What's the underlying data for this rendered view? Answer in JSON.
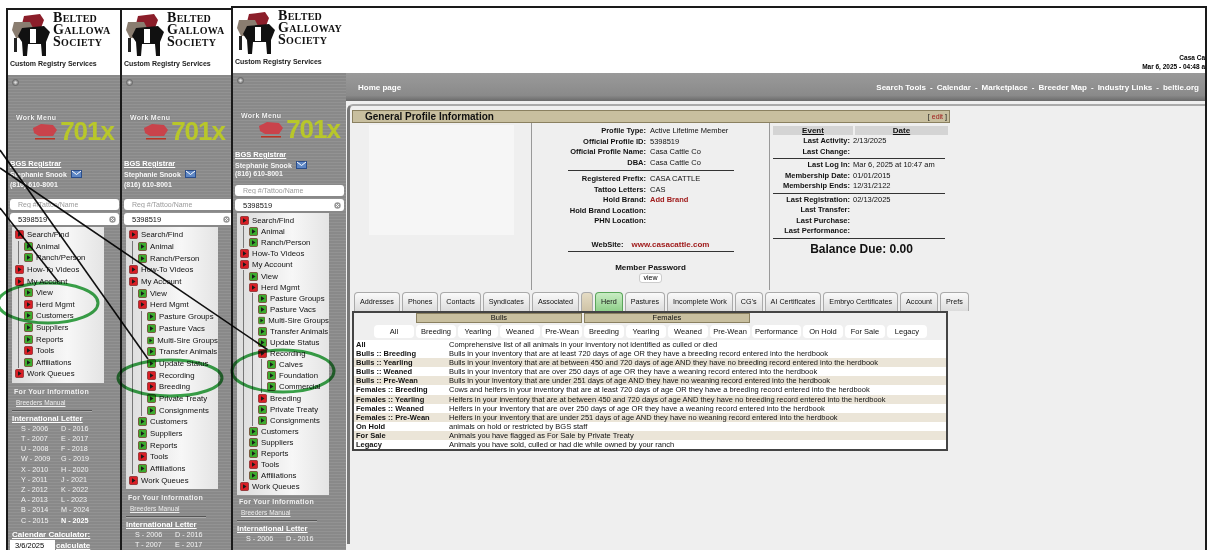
{
  "panels": [
    {
      "brand": [
        "Belted",
        "Gallowa",
        "Society"
      ],
      "tagline": "Custom Registry Services",
      "work_menu": "Work Menu",
      "product": "701x",
      "registrar": {
        "title": "BGS Registrar",
        "name": "Stephanie Snook",
        "phone": "(816) 610-8001"
      },
      "search": {
        "placeholder": "Reg #/Tattoo/Name"
      },
      "reg_field": {
        "value": "5398519"
      },
      "menu": [
        {
          "label": "Search/Find",
          "kind": "folder",
          "children": [
            {
              "label": "Animal",
              "kind": "page"
            },
            {
              "label": "Ranch/Person",
              "kind": "page"
            }
          ]
        },
        {
          "label": "How-To Videos",
          "kind": "folder"
        },
        {
          "label": "My Account",
          "kind": "folder",
          "children": [
            {
              "label": "View",
              "kind": "page"
            },
            {
              "label": "Herd Mgmt",
              "kind": "folder"
            },
            {
              "label": "Customers",
              "kind": "page"
            },
            {
              "label": "Suppliers",
              "kind": "page"
            },
            {
              "label": "Reports",
              "kind": "page"
            },
            {
              "label": "Tools",
              "kind": "folder"
            },
            {
              "label": "Affiliations",
              "kind": "page"
            }
          ]
        },
        {
          "label": "Work Queues",
          "kind": "folder"
        }
      ],
      "info_heading": "For Your Information",
      "manual": "Breeders Manual",
      "letter_heading": "International Letter",
      "letters": [
        {
          "text": "S - 2006",
          "current": false
        },
        {
          "text": "D - 2016",
          "current": false
        },
        {
          "text": "T - 2007",
          "current": false
        },
        {
          "text": "E - 2017",
          "current": false
        },
        {
          "text": "U - 2008",
          "current": false
        },
        {
          "text": "F - 2018",
          "current": false
        },
        {
          "text": "W - 2009",
          "current": false
        },
        {
          "text": "G - 2019",
          "current": false
        },
        {
          "text": "X - 2010",
          "current": false
        },
        {
          "text": "H - 2020",
          "current": false
        },
        {
          "text": "Y - 2011",
          "current": false
        },
        {
          "text": "J - 2021",
          "current": false
        },
        {
          "text": "Z - 2012",
          "current": false
        },
        {
          "text": "K - 2022",
          "current": false
        },
        {
          "text": "A - 2013",
          "current": false
        },
        {
          "text": "L - 2023",
          "current": false
        },
        {
          "text": "B - 2014",
          "current": false
        },
        {
          "text": "M - 2024",
          "current": false
        },
        {
          "text": "C - 2015",
          "current": false
        },
        {
          "text": "N - 2025",
          "current": true
        }
      ],
      "calendar": {
        "label": "Calendar Calculator:",
        "value": "3/6/2025",
        "button": "calculate"
      }
    },
    {
      "brand": [
        "Belted",
        "Gallowa",
        "Society"
      ],
      "tagline": "Custom Registry Services",
      "work_menu": "Work Menu",
      "product": "701x",
      "registrar": {
        "title": "BGS Registrar",
        "name": "Stephanie Snook",
        "phone": "(816) 610-8001"
      },
      "search": {
        "placeholder": "Reg #/Tattoo/Name"
      },
      "reg_field": {
        "value": "5398519"
      },
      "menu": [
        {
          "label": "Search/Find",
          "kind": "folder",
          "children": [
            {
              "label": "Animal",
              "kind": "page"
            },
            {
              "label": "Ranch/Person",
              "kind": "page"
            }
          ]
        },
        {
          "label": "How-To Videos",
          "kind": "folder"
        },
        {
          "label": "My Account",
          "kind": "folder",
          "children": [
            {
              "label": "View",
              "kind": "page"
            },
            {
              "label": "Herd Mgmt",
              "kind": "folder",
              "children": [
                {
                  "label": "Pasture Groups",
                  "kind": "page"
                },
                {
                  "label": "Pasture Vacs",
                  "kind": "page"
                },
                {
                  "label": "Multi-Sire Groups",
                  "kind": "page"
                },
                {
                  "label": "Transfer Animals",
                  "kind": "page"
                },
                {
                  "label": "Update Status",
                  "kind": "page"
                },
                {
                  "label": "Recording",
                  "kind": "folder"
                },
                {
                  "label": "Breeding",
                  "kind": "folder"
                },
                {
                  "label": "Private Treaty",
                  "kind": "page"
                },
                {
                  "label": "Consignments",
                  "kind": "page"
                }
              ]
            },
            {
              "label": "Customers",
              "kind": "page"
            },
            {
              "label": "Suppliers",
              "kind": "page"
            },
            {
              "label": "Reports",
              "kind": "page"
            },
            {
              "label": "Tools",
              "kind": "folder"
            },
            {
              "label": "Affiliations",
              "kind": "page"
            }
          ]
        },
        {
          "label": "Work Queues",
          "kind": "folder"
        }
      ],
      "info_heading": "For Your Information",
      "manual": "Breeders Manual",
      "letter_heading": "International Letter",
      "letters": [
        {
          "text": "S - 2006",
          "current": false
        },
        {
          "text": "D - 2016",
          "current": false
        },
        {
          "text": "T - 2007",
          "current": false
        },
        {
          "text": "E - 2017",
          "current": false
        }
      ]
    },
    {
      "brand": [
        "Belted",
        "Galloway",
        "Society"
      ],
      "tagline": "Custom Registry Services",
      "work_menu": "Work Menu",
      "product": "701x",
      "registrar": {
        "title": "BGS Registrar",
        "name": "Stephanie Snook",
        "phone": "(816) 610-8001"
      },
      "search": {
        "placeholder": "Reg #/Tattoo/Name"
      },
      "reg_field": {
        "value": "5398519"
      },
      "menu": [
        {
          "label": "Search/Find",
          "kind": "folder",
          "children": [
            {
              "label": "Animal",
              "kind": "page"
            },
            {
              "label": "Ranch/Person",
              "kind": "page"
            }
          ]
        },
        {
          "label": "How-To Videos",
          "kind": "folder"
        },
        {
          "label": "My Account",
          "kind": "folder",
          "children": [
            {
              "label": "View",
              "kind": "page"
            },
            {
              "label": "Herd Mgmt",
              "kind": "folder",
              "children": [
                {
                  "label": "Pasture Groups",
                  "kind": "page"
                },
                {
                  "label": "Pasture Vacs",
                  "kind": "page"
                },
                {
                  "label": "Multi-Sire Groups",
                  "kind": "page"
                },
                {
                  "label": "Transfer Animals",
                  "kind": "page"
                },
                {
                  "label": "Update Status",
                  "kind": "page"
                },
                {
                  "label": "Recording",
                  "kind": "folder",
                  "children": [
                    {
                      "label": "Calves",
                      "kind": "page"
                    },
                    {
                      "label": "Foundation",
                      "kind": "page"
                    },
                    {
                      "label": "Commercial",
                      "kind": "page"
                    }
                  ]
                },
                {
                  "label": "Breeding",
                  "kind": "folder"
                },
                {
                  "label": "Private Treaty",
                  "kind": "page"
                },
                {
                  "label": "Consignments",
                  "kind": "page"
                }
              ]
            },
            {
              "label": "Customers",
              "kind": "page"
            },
            {
              "label": "Suppliers",
              "kind": "page"
            },
            {
              "label": "Reports",
              "kind": "page"
            },
            {
              "label": "Tools",
              "kind": "folder"
            },
            {
              "label": "Affiliations",
              "kind": "page"
            }
          ]
        },
        {
          "label": "Work Queues",
          "kind": "folder"
        }
      ],
      "info_heading": "For Your Information",
      "manual": "Breeders Manual",
      "letter_heading": "International Letter",
      "letters": [
        {
          "text": "S - 2006",
          "current": false
        },
        {
          "text": "D - 2016",
          "current": false
        }
      ],
      "account": {
        "name": "Casa Ca",
        "datetime": "Mar 6, 2025 - 04:48 a"
      },
      "main": {
        "nav": {
          "home": "Home page",
          "separator": "-",
          "links": [
            "Search Tools",
            "Calendar",
            "Marketplace",
            "Breeder Map",
            "Industry Links",
            "beltie.org"
          ]
        },
        "profile": {
          "title": "General Profile Information",
          "edit_open": "[",
          "edit": "edit",
          "edit_close": "]",
          "groups": [
            [
              {
                "label": "Profile Type:",
                "value": "Active Lifetime Member",
                "kind": "text"
              },
              {
                "label": "Official Profile ID:",
                "value": "5398519",
                "kind": "text"
              },
              {
                "label": "Official Profile Name:",
                "value": "Casa Cattle Co",
                "kind": "text"
              },
              {
                "label": "DBA:",
                "value": "Casa Cattle Co",
                "kind": "text"
              }
            ],
            [
              {
                "label": "Registered Prefix:",
                "value": "CASA CATTLE",
                "kind": "text"
              },
              {
                "label": "Tattoo Letters:",
                "value": "CAS",
                "kind": "text"
              },
              {
                "label": "Hold Brand:",
                "value": "Add Brand",
                "kind": "link"
              },
              {
                "label": "Hold Brand Location:",
                "kind": "text"
              },
              {
                "label": "PHN Location:",
                "kind": "text"
              }
            ]
          ],
          "website": {
            "label": "WebSite:",
            "value": "www.casacattle.com"
          },
          "password": {
            "label": "Member Password",
            "button": "view"
          },
          "events": {
            "columns": [
              "Event",
              "Date"
            ],
            "groups": [
              [
                {
                  "label": "Last Activity:",
                  "value": "2/13/2025"
                },
                {
                  "label": "Last Change:"
                }
              ],
              [
                {
                  "label": "Last Log In:",
                  "value": "Mar 6, 2025 at 10:47 am"
                },
                {
                  "label": "Membership Date:",
                  "value": "01/01/2015"
                },
                {
                  "label": "Membership Ends:",
                  "value": "12/31/2122"
                }
              ],
              [
                {
                  "label": "Last Registration:",
                  "value": "02/13/2025"
                },
                {
                  "label": "Last Transfer:"
                },
                {
                  "label": "Last Purchase:"
                },
                {
                  "label": "Last Performance:"
                }
              ]
            ]
          },
          "balance": "Balance Due: 0.00"
        },
        "tabs": [
          {
            "kind": "label",
            "label": "Addresses",
            "selected": false
          },
          {
            "kind": "label",
            "label": "Phones",
            "selected": false
          },
          {
            "kind": "label",
            "label": "Contacts",
            "selected": false
          },
          {
            "kind": "label",
            "label": "Syndicates",
            "selected": false
          },
          {
            "kind": "label",
            "label": "Associated",
            "selected": false
          },
          {
            "kind": "blank",
            "selected": false
          },
          {
            "kind": "label",
            "label": "Herd",
            "selected": true
          },
          {
            "kind": "label",
            "label": "Pastures",
            "selected": false
          },
          {
            "kind": "label",
            "label": "Incomplete Work",
            "selected": false
          },
          {
            "kind": "label",
            "label": "CG's",
            "selected": false
          },
          {
            "kind": "label",
            "label": "AI Certificates",
            "selected": false
          },
          {
            "kind": "label",
            "label": "Embryo Certificates",
            "selected": false
          },
          {
            "kind": "label",
            "label": "Account",
            "selected": false
          },
          {
            "kind": "label",
            "label": "Prefs",
            "selected": false
          }
        ],
        "filters": [
          {
            "kind": "single",
            "label": "All"
          },
          {
            "kind": "group",
            "label": "Bulls",
            "items": [
              "Breeding",
              "Yearling",
              "Weaned",
              "Pre-Wean"
            ]
          },
          {
            "kind": "group",
            "label": "Females",
            "items": [
              "Breeding",
              "Yearling",
              "Weaned",
              "Pre-Wean"
            ]
          },
          {
            "kind": "single",
            "label": "Performance"
          },
          {
            "kind": "single",
            "label": "On Hold"
          },
          {
            "kind": "single",
            "label": "For Sale"
          },
          {
            "kind": "single",
            "label": "Legacy"
          }
        ],
        "rows": [
          {
            "name": "All",
            "description": "Comprehensive list of all animals in your inventory not identified as culled or died"
          },
          {
            "name": "Bulls :: Breeding",
            "description": "Bulls in your inventory that are at least 720 days of age OR they have a breeding record entered into the herdbook"
          },
          {
            "name": "Bulls :: Yearling",
            "description": "Bulls in your inventory that are at between 450 and 720 days of age AND they have no breeding record entered into the herdbook"
          },
          {
            "name": "Bulls :: Weaned",
            "description": "Bulls in your inventory that are over 250 days of age OR they have a weaning record entered into the herdbook"
          },
          {
            "name": "Bulls :: Pre-Wean",
            "description": "Bulls in your inventory that are under 251 days of age AND they have no weaning record entered into the herdbook"
          },
          {
            "name": "Females :: Breeding",
            "description": "Cows and heifers in your inventory that are at least 720 days of age OR they have a breeding record entered into the herdbook"
          },
          {
            "name": "Females :: Yearling",
            "description": "Heifers in your inventory that are at between 450 and 720 days of age AND they have no breeding record entered into the herdbook"
          },
          {
            "name": "Females :: Weaned",
            "description": "Heifers in your inventory that are over 250 days of age OR they have a weaning record entered into the herdbook"
          },
          {
            "name": "Females :: Pre-Wean",
            "description": "Heifers in your inventory that are under 251 days of age AND they have no weaning record entered into the herdbook"
          },
          {
            "name": "On Hold",
            "description": "animals on hold or restricted by BGS staff"
          },
          {
            "name": "For Sale",
            "description": "Animals you have flagged as For Sale by Private Treaty"
          },
          {
            "name": "Legacy",
            "description": "Animals you have sold, culled or had die while owned by your ranch"
          }
        ]
      }
    }
  ]
}
